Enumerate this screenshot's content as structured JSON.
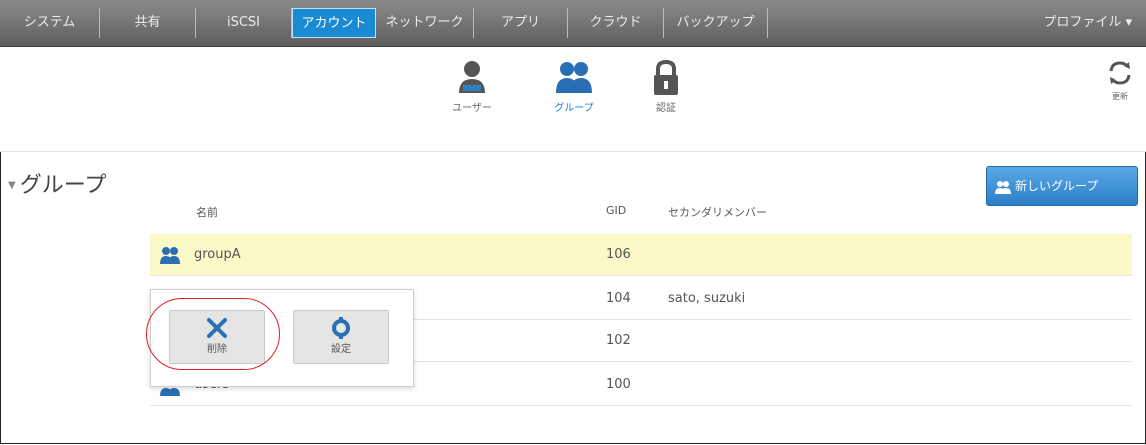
{
  "menu": {
    "items": [
      "システム",
      "共有",
      "iSCSI",
      "アカウント",
      "ネットワーク",
      "アプリ",
      "クラウド",
      "バックアップ"
    ],
    "active_index": 3,
    "profile": "プロファイル ▾"
  },
  "toolbar": {
    "users_label": "ユーザー",
    "groups_label": "グループ",
    "auth_label": "認証",
    "refresh_label": "更新"
  },
  "section": {
    "title": "グループ"
  },
  "new_group_button": "新しいグループ",
  "table": {
    "headers": {
      "name": "名前",
      "gid": "GID",
      "secondary": "セカンダリメンバー"
    },
    "rows": [
      {
        "name": "groupA",
        "gid": "106",
        "secondary": ""
      },
      {
        "name": "",
        "gid": "104",
        "secondary": "sato, suzuki"
      },
      {
        "name": "",
        "gid": "102",
        "secondary": ""
      },
      {
        "name": "users",
        "gid": "100",
        "secondary": ""
      }
    ]
  },
  "popup": {
    "delete_label": "削除",
    "settings_label": "設定"
  },
  "colors": {
    "accent": "#1a8bd2",
    "selected_row": "#fbf9c8",
    "highlight": "#dd2222"
  }
}
